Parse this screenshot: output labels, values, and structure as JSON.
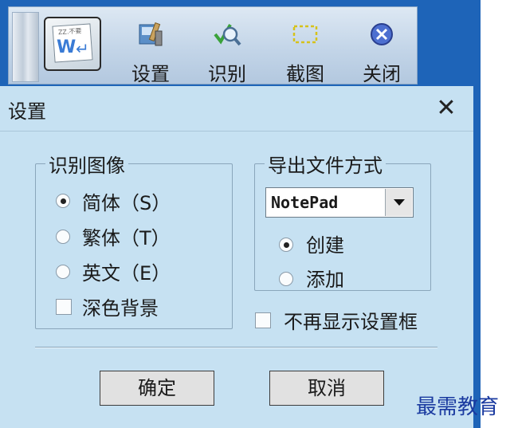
{
  "toolbar": {
    "buttons": [
      {
        "label": "设置",
        "icon": "settings-tools-icon"
      },
      {
        "label": "识别",
        "icon": "magnifier-check-icon"
      },
      {
        "label": "截图",
        "icon": "dashed-rect-icon"
      },
      {
        "label": "关闭",
        "icon": "close-circle-icon"
      }
    ],
    "app_icon": {
      "small_text": "ZZ.不要",
      "letter": "W",
      "arrow": "↵"
    }
  },
  "dialog": {
    "title": "设置",
    "close_glyph": "✕",
    "recognize_group": {
      "legend": "识别图像",
      "options": [
        {
          "label": "简体（S）",
          "selected": true
        },
        {
          "label": "繁体（T）",
          "selected": false
        },
        {
          "label": "英文（E）",
          "selected": false
        }
      ],
      "dark_color": {
        "label": "深色背景",
        "checked": false
      }
    },
    "export_group": {
      "legend": "导出文件方式",
      "select_value": "NotePad",
      "options": [
        {
          "label": "创建",
          "selected": true
        },
        {
          "label": "添加",
          "selected": false
        }
      ]
    },
    "no_show": {
      "label": "不再显示设置框",
      "checked": false
    },
    "ok_label": "确定",
    "cancel_label": "取消"
  },
  "watermark": "最需教育",
  "colors": {
    "dialog_bg": "#c6e1f2",
    "outer_blue": "#1e64b8",
    "toolbar_bg": "#c3d5e8"
  }
}
